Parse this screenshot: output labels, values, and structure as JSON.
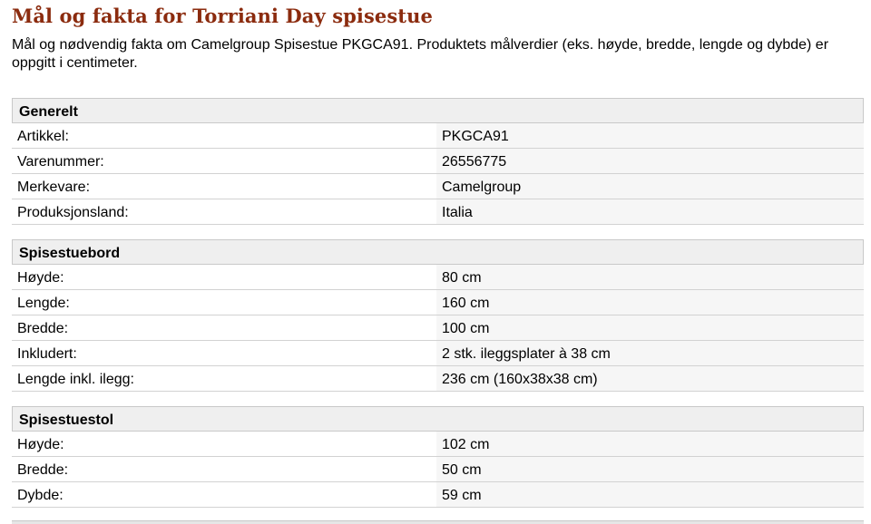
{
  "header": {
    "title": "Mål og fakta for Torriani Day spisestue",
    "intro": "Mål og nødvendig fakta om Camelgroup Spisestue PKGCA91. Produktets målverdier (eks. høyde, bredde, lengde og dybde) er oppgitt i centimeter."
  },
  "sections": [
    {
      "title": "Generelt",
      "rows": [
        {
          "label": "Artikkel:",
          "value": "PKGCA91"
        },
        {
          "label": "Varenummer:",
          "value": "26556775"
        },
        {
          "label": "Merkevare:",
          "value": "Camelgroup"
        },
        {
          "label": "Produksjonsland:",
          "value": "Italia"
        }
      ]
    },
    {
      "title": "Spisestuebord",
      "rows": [
        {
          "label": "Høyde:",
          "value": "80 cm"
        },
        {
          "label": "Lengde:",
          "value": "160 cm"
        },
        {
          "label": "Bredde:",
          "value": "100 cm"
        },
        {
          "label": "Inkludert:",
          "value": "2 stk. ileggsplater à 38 cm"
        },
        {
          "label": "Lengde inkl. ilegg:",
          "value": "236 cm (160x38x38 cm)"
        }
      ]
    },
    {
      "title": "Spisestuestol",
      "rows": [
        {
          "label": "Høyde:",
          "value": "102 cm"
        },
        {
          "label": "Bredde:",
          "value": "50 cm"
        },
        {
          "label": "Dybde:",
          "value": "59 cm"
        }
      ]
    }
  ],
  "colors": {
    "title": "#8b2b0e",
    "section_header_bg": "#efefef",
    "value_cell_bg": "#f6f6f6"
  }
}
